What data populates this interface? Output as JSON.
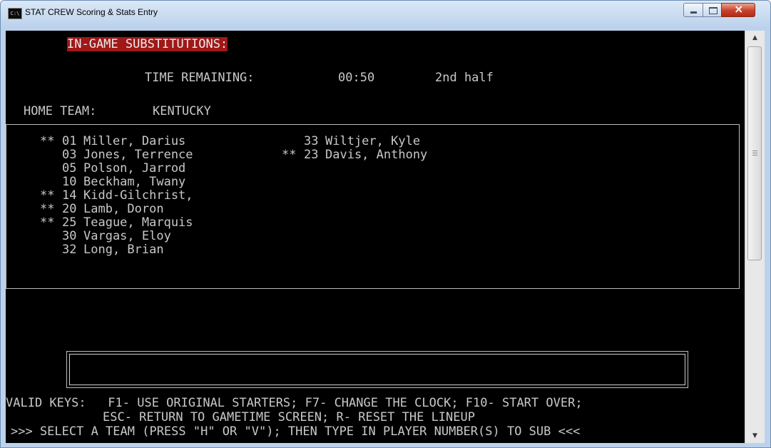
{
  "window": {
    "title": "STAT CREW Scoring & Stats Entry",
    "icon": "console-app-icon",
    "buttons": [
      "minimize-icon",
      "maximize-icon",
      "close-icon"
    ]
  },
  "screen": {
    "header": "IN-GAME SUBSTITUTIONS:",
    "time_label": "TIME REMAINING:",
    "time_value": "00:50",
    "period": "2nd half",
    "team_label": "HOME TEAM:",
    "team_name": "KENTUCKY"
  },
  "roster_left": [
    {
      "marker": "**",
      "number": "01",
      "name": "Miller, Darius"
    },
    {
      "marker": "",
      "number": "03",
      "name": "Jones, Terrence"
    },
    {
      "marker": "",
      "number": "05",
      "name": "Polson, Jarrod"
    },
    {
      "marker": "",
      "number": "10",
      "name": "Beckham, Twany"
    },
    {
      "marker": "**",
      "number": "14",
      "name": "Kidd-Gilchrist,"
    },
    {
      "marker": "**",
      "number": "20",
      "name": "Lamb, Doron"
    },
    {
      "marker": "**",
      "number": "25",
      "name": "Teague, Marquis"
    },
    {
      "marker": "",
      "number": "30",
      "name": "Vargas, Eloy"
    },
    {
      "marker": "",
      "number": "32",
      "name": "Long, Brian"
    }
  ],
  "roster_right": [
    {
      "marker": "",
      "number": "33",
      "name": "Wiltjer, Kyle"
    },
    {
      "marker": "**",
      "number": "23",
      "name": "Davis, Anthony"
    }
  ],
  "input": {
    "value": ""
  },
  "footer": {
    "line1": "VALID KEYS:   F1- USE ORIGINAL STARTERS; F7- CHANGE THE CLOCK; F10- START OVER;",
    "line2": "ESC- RETURN TO GAMETIME SCREEN; R- RESET THE LINEUP",
    "line3": ">>> SELECT A TEAM (PRESS \"H\" OR \"V\"); THEN TYPE IN PLAYER NUMBER(S) TO SUB <<<"
  },
  "colors": {
    "background": "#000000",
    "text": "#c8c8c8",
    "header_highlight": "#a01818"
  }
}
